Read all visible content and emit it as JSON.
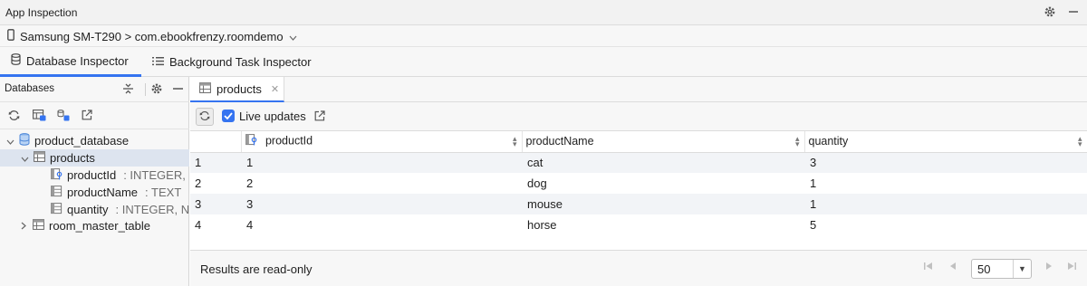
{
  "window": {
    "title": "App Inspection"
  },
  "device": {
    "selector": "Samsung SM-T290 > com.ebookfrenzy.roomdemo"
  },
  "tabs": [
    {
      "label": "Database Inspector",
      "active": true
    },
    {
      "label": "Background Task Inspector",
      "active": false
    }
  ],
  "databases_panel": {
    "title": "Databases",
    "tree": {
      "database": "product_database",
      "tables": [
        {
          "name": "products",
          "expanded": true,
          "columns": [
            {
              "name": "productId",
              "type": ":  INTEGER,"
            },
            {
              "name": "productName",
              "type": ":  TEXT"
            },
            {
              "name": "quantity",
              "type": ":  INTEGER, N"
            }
          ]
        },
        {
          "name": "room_master_table",
          "expanded": false
        }
      ]
    }
  },
  "editor": {
    "tab_label": "products",
    "live_updates_label": "Live updates",
    "live_updates_checked": true,
    "columns": [
      "productId",
      "productName",
      "quantity"
    ],
    "rows": [
      {
        "index": "1",
        "productId": "1",
        "productName": "cat",
        "quantity": "3"
      },
      {
        "index": "2",
        "productId": "2",
        "productName": "dog",
        "quantity": "1"
      },
      {
        "index": "3",
        "productId": "3",
        "productName": "mouse",
        "quantity": "1"
      },
      {
        "index": "4",
        "productId": "4",
        "productName": "horse",
        "quantity": "5"
      }
    ],
    "footer_text": "Results are read-only",
    "page_size": "50"
  },
  "colors": {
    "accent": "#3574f0",
    "selection": "#dde4ef",
    "row_alt": "#f2f4f7"
  }
}
